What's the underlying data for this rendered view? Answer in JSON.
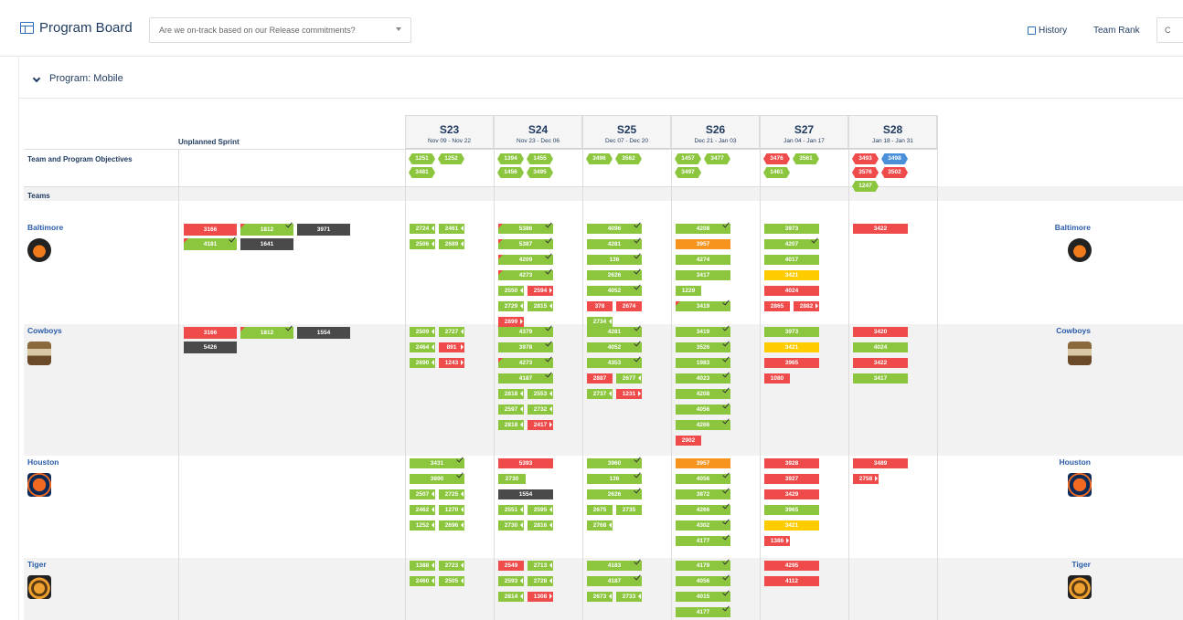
{
  "header": {
    "title": "Program Board",
    "question": "Are we on-track based on our Release commitments?",
    "history_label": "History",
    "team_rank_label": "Team Rank",
    "cut_button_label": "C"
  },
  "program": {
    "title": "Program: Mobile"
  },
  "grid": {
    "unplanned_label": "Unplanned Sprint",
    "objectives_label": "Team and Program Objectives",
    "teams_label": "Teams"
  },
  "sprints": [
    {
      "name": "S23",
      "dates": "Nov 09 - Nov 22"
    },
    {
      "name": "S24",
      "dates": "Nov 23 - Dec 06"
    },
    {
      "name": "S25",
      "dates": "Dec 07 - Dec 20"
    },
    {
      "name": "S26",
      "dates": "Dec 21 - Jan 03"
    },
    {
      "name": "S27",
      "dates": "Jan 04 - Jan 17"
    },
    {
      "name": "S28",
      "dates": "Jan 18 - Jan 31"
    }
  ],
  "objectives": [
    [
      {
        "id": "1251",
        "c": "g"
      },
      {
        "id": "1252",
        "c": "g"
      },
      {
        "id": "3481",
        "c": "g"
      }
    ],
    [
      {
        "id": "1394",
        "c": "g"
      },
      {
        "id": "1455",
        "c": "g"
      },
      {
        "id": "1456",
        "c": "g"
      },
      {
        "id": "3495",
        "c": "g"
      }
    ],
    [
      {
        "id": "3496",
        "c": "g"
      },
      {
        "id": "3562",
        "c": "g"
      }
    ],
    [
      {
        "id": "1457",
        "c": "g"
      },
      {
        "id": "3477",
        "c": "g"
      },
      {
        "id": "3497",
        "c": "g"
      }
    ],
    [
      {
        "id": "3476",
        "c": "r"
      },
      {
        "id": "3561",
        "c": "g"
      },
      {
        "id": "1461",
        "c": "g"
      }
    ],
    [
      {
        "id": "3493",
        "c": "r"
      },
      {
        "id": "3498",
        "c": "b"
      },
      {
        "id": "3576",
        "c": "r"
      },
      {
        "id": "3502",
        "c": "r"
      },
      {
        "id": "1247",
        "c": "g"
      }
    ]
  ],
  "teams": [
    {
      "name": "Baltimore",
      "logo": "orioles-logo",
      "unplanned": [
        {
          "id": "3166",
          "c": "r"
        },
        {
          "id": "1812",
          "c": "g",
          "tick": true,
          "flag": true
        },
        {
          "id": "3971",
          "c": "k"
        },
        {
          "id": "4181",
          "c": "g",
          "tick": true,
          "flag": true
        },
        {
          "id": "1641",
          "c": "k"
        }
      ],
      "sprints": [
        [
          [
            "2724",
            "g",
            "a"
          ],
          [
            "2461",
            "g",
            "a"
          ],
          [
            "2506",
            "g",
            "a"
          ],
          [
            "2689",
            "g",
            "a"
          ]
        ],
        [
          [
            "5386",
            "g",
            "t"
          ],
          [
            "5387",
            "g",
            "t"
          ],
          [
            "4209",
            "g",
            "t"
          ],
          [
            "4273",
            "g",
            "t"
          ],
          [
            "2550",
            "g",
            "a"
          ],
          [
            "2594",
            "r",
            "a"
          ],
          [
            "2729",
            "g",
            "a"
          ],
          [
            "2815",
            "g",
            "a"
          ],
          [
            "2899",
            "r",
            "a"
          ]
        ],
        [
          [
            "4096",
            "g",
            "t"
          ],
          [
            "4281",
            "g",
            "t"
          ],
          [
            "136",
            "g",
            "t"
          ],
          [
            "2626",
            "g",
            "t"
          ],
          [
            "4052",
            "g",
            "t"
          ],
          [
            "378",
            "r",
            ""
          ],
          [
            "2674",
            "r",
            ""
          ],
          [
            "2734",
            "g",
            "a"
          ]
        ],
        [
          [
            "4208",
            "g",
            "t"
          ],
          [
            "3957",
            "o",
            ""
          ],
          [
            "4274",
            "g",
            ""
          ],
          [
            "3417",
            "g",
            ""
          ],
          [
            "1229",
            "g",
            ""
          ],
          [
            "3419",
            "g",
            "t"
          ]
        ],
        [
          [
            "3973",
            "g",
            ""
          ],
          [
            "4207",
            "g",
            "t"
          ],
          [
            "4017",
            "g",
            ""
          ],
          [
            "3421",
            "y",
            ""
          ],
          [
            "4024",
            "r",
            ""
          ],
          [
            "2865",
            "r",
            ""
          ],
          [
            "2882",
            "r",
            "a"
          ]
        ],
        [
          [
            "3422",
            "r",
            ""
          ]
        ]
      ]
    },
    {
      "name": "Cowboys",
      "logo": "cowboys-logo",
      "unplanned": [
        {
          "id": "3166",
          "c": "r"
        },
        {
          "id": "1812",
          "c": "g",
          "tick": true,
          "flag": true
        },
        {
          "id": "1554",
          "c": "k"
        },
        {
          "id": "5426",
          "c": "k"
        }
      ],
      "sprints": [
        [
          [
            "2509",
            "g",
            "a"
          ],
          [
            "2727",
            "g",
            "a"
          ],
          [
            "2464",
            "g",
            "a"
          ],
          [
            "891",
            "r",
            "a"
          ],
          [
            "2690",
            "g",
            "a"
          ],
          [
            "1243",
            "r",
            "a"
          ]
        ],
        [
          [
            "4379",
            "g",
            "t"
          ],
          [
            "3978",
            "g",
            "t"
          ],
          [
            "4273",
            "g",
            "t"
          ],
          [
            "4187",
            "g",
            "t"
          ],
          [
            "2818",
            "g",
            "a"
          ],
          [
            "2553",
            "g",
            "a"
          ],
          [
            "2597",
            "g",
            "a"
          ],
          [
            "2732",
            "g",
            "a"
          ],
          [
            "2818",
            "g",
            "a"
          ],
          [
            "2417",
            "r",
            "a"
          ]
        ],
        [
          [
            "4281",
            "g",
            "t"
          ],
          [
            "4052",
            "g",
            "t"
          ],
          [
            "4353",
            "g",
            "t"
          ],
          [
            "2887",
            "r",
            ""
          ],
          [
            "2677",
            "g",
            "a"
          ],
          [
            "2737",
            "g",
            "a"
          ],
          [
            "1231",
            "r",
            "a"
          ]
        ],
        [
          [
            "3419",
            "g",
            "t"
          ],
          [
            "3526",
            "g",
            "t"
          ],
          [
            "1983",
            "g",
            "t"
          ],
          [
            "4023",
            "g",
            "t"
          ],
          [
            "4208",
            "g",
            "t"
          ],
          [
            "4056",
            "g",
            "t"
          ],
          [
            "4266",
            "g",
            "t"
          ],
          [
            "2902",
            "r",
            ""
          ]
        ],
        [
          [
            "3973",
            "g",
            ""
          ],
          [
            "3421",
            "y",
            ""
          ],
          [
            "3965",
            "r",
            ""
          ],
          [
            "1080",
            "r",
            ""
          ]
        ],
        [
          [
            "3420",
            "r",
            ""
          ],
          [
            "4024",
            "g",
            ""
          ],
          [
            "3422",
            "r",
            ""
          ],
          [
            "3417",
            "g",
            ""
          ]
        ]
      ]
    },
    {
      "name": "Houston",
      "logo": "astros-logo",
      "unplanned": [],
      "sprints": [
        [
          [
            "3431",
            "g",
            "t"
          ],
          [
            "3890",
            "g",
            "t"
          ],
          [
            "2507",
            "g",
            "a"
          ],
          [
            "2725",
            "g",
            "a"
          ],
          [
            "2462",
            "g",
            "a"
          ],
          [
            "1270",
            "g",
            "a"
          ],
          [
            "1252",
            "g",
            "a"
          ],
          [
            "2696",
            "g",
            "a"
          ]
        ],
        [
          [
            "5393",
            "r",
            ""
          ],
          [
            "2730",
            "g",
            ""
          ],
          [
            "1554",
            "k",
            ""
          ],
          [
            "2551",
            "g",
            "a"
          ],
          [
            "2595",
            "g",
            "a"
          ],
          [
            "2730",
            "g",
            "a"
          ],
          [
            "2816",
            "g",
            "a"
          ]
        ],
        [
          [
            "3960",
            "g",
            "t"
          ],
          [
            "136",
            "g",
            "t"
          ],
          [
            "2626",
            "g",
            "t"
          ],
          [
            "2675",
            "g",
            ""
          ],
          [
            "2735",
            "g",
            ""
          ],
          [
            "2768",
            "g",
            "a"
          ]
        ],
        [
          [
            "3957",
            "o",
            ""
          ],
          [
            "4056",
            "g",
            "t"
          ],
          [
            "3872",
            "g",
            "t"
          ],
          [
            "4266",
            "g",
            "t"
          ],
          [
            "4302",
            "g",
            "t"
          ],
          [
            "4177",
            "g",
            "t"
          ]
        ],
        [
          [
            "3928",
            "r",
            ""
          ],
          [
            "3927",
            "r",
            ""
          ],
          [
            "3429",
            "r",
            ""
          ],
          [
            "3965",
            "g",
            ""
          ],
          [
            "3421",
            "y",
            ""
          ],
          [
            "1386",
            "r",
            "a"
          ]
        ],
        [
          [
            "3489",
            "r",
            ""
          ],
          [
            "2758",
            "r",
            "a"
          ]
        ]
      ]
    },
    {
      "name": "Tiger",
      "logo": "tiger-logo",
      "unplanned": [],
      "sprints": [
        [
          [
            "1388",
            "g",
            "a"
          ],
          [
            "2723",
            "g",
            "a"
          ],
          [
            "2460",
            "g",
            "a"
          ],
          [
            "2505",
            "g",
            "a"
          ]
        ],
        [
          [
            "2549",
            "r",
            ""
          ],
          [
            "2713",
            "g",
            "a"
          ],
          [
            "2593",
            "g",
            "a"
          ],
          [
            "2728",
            "g",
            "a"
          ],
          [
            "2814",
            "g",
            "a"
          ],
          [
            "1308",
            "r",
            "a"
          ]
        ],
        [
          [
            "4183",
            "g",
            "t"
          ],
          [
            "4187",
            "g",
            "t"
          ],
          [
            "2673",
            "g",
            "a"
          ],
          [
            "2733",
            "g",
            "a"
          ]
        ],
        [
          [
            "4179",
            "g",
            "t"
          ],
          [
            "4056",
            "g",
            "t"
          ],
          [
            "4015",
            "g",
            "t"
          ],
          [
            "4177",
            "g",
            "t"
          ]
        ],
        [
          [
            "4295",
            "r",
            ""
          ],
          [
            "4112",
            "r",
            ""
          ]
        ],
        []
      ]
    }
  ],
  "colors": {
    "green": "#8cc63f",
    "red": "#ef4b4b",
    "dark": "#4a4a4a",
    "orange": "#f7941d",
    "yellow": "#ffcc00",
    "blue": "#4a90d9",
    "accent": "#2a6ebb"
  }
}
